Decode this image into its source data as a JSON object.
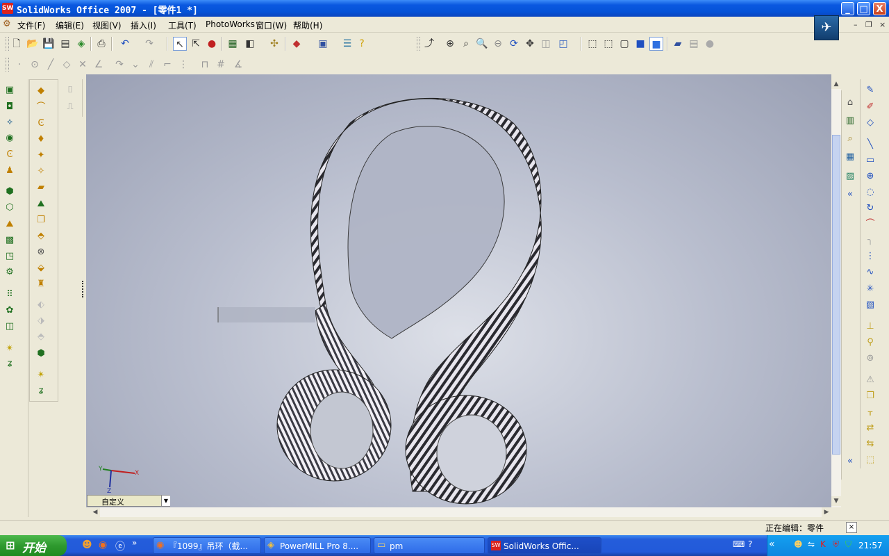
{
  "window": {
    "title": "SolidWorks Office 2007 - [零件1 *]",
    "app_icon_label": "SW",
    "minimize": "_",
    "maximize": "□",
    "close": "X"
  },
  "menu": {
    "items": [
      "文件(F)",
      "编辑(E)",
      "视图(V)",
      "插入(I)",
      "工具(T)",
      "PhotoWorks",
      "窗口(W)",
      "帮助(H)"
    ],
    "mdi_minimize": "–",
    "mdi_restore": "❐",
    "mdi_close": "×"
  },
  "viewport": {
    "view_orientation": "自定义",
    "triad": {
      "x": "X",
      "y": "Y",
      "z": "Z"
    }
  },
  "status": {
    "text": "正在编辑：零件",
    "close": "×"
  },
  "taskbar": {
    "start_label": "开始",
    "tasks": [
      {
        "label": "『1099』吊环（截...",
        "icon": "firefox-icon"
      },
      {
        "label": "PowerMILL Pro 8....",
        "icon": "powermill-icon"
      },
      {
        "label": "pm",
        "icon": "folder-icon"
      },
      {
        "label": "SolidWorks Offic...",
        "icon": "solidworks-icon"
      }
    ],
    "clock": "21:57"
  },
  "colors": {
    "titlebar": "#0A58E0",
    "taskbar": "#245DDB",
    "start": "#2F9A2F",
    "viewport": "#B9BECE"
  }
}
